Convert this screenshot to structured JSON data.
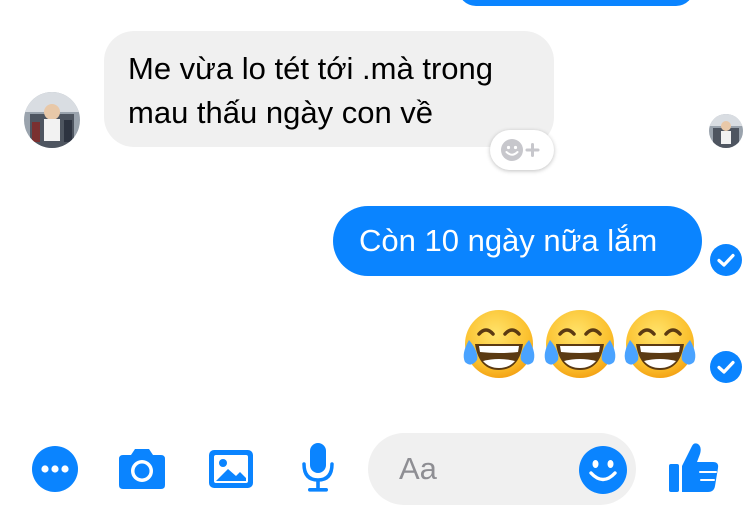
{
  "messages": {
    "incoming_text": "Me vừa lo tét tới .mà trong mau thấu ngày con về",
    "outgoing_text": "Còn 10 ngày nữa lắm",
    "emoji_message": [
      "face-with-tears-of-joy",
      "face-with-tears-of-joy",
      "face-with-tears-of-joy"
    ]
  },
  "composer": {
    "placeholder": "Aa",
    "icons": [
      "more-icon",
      "camera-icon",
      "image-icon",
      "microphone-icon",
      "smile-icon",
      "thumbs-up-icon"
    ]
  },
  "colors": {
    "accent": "#0a84ff",
    "incoming_bubble": "#f0f0f0",
    "emoji_yellow": "#fbc02d"
  }
}
